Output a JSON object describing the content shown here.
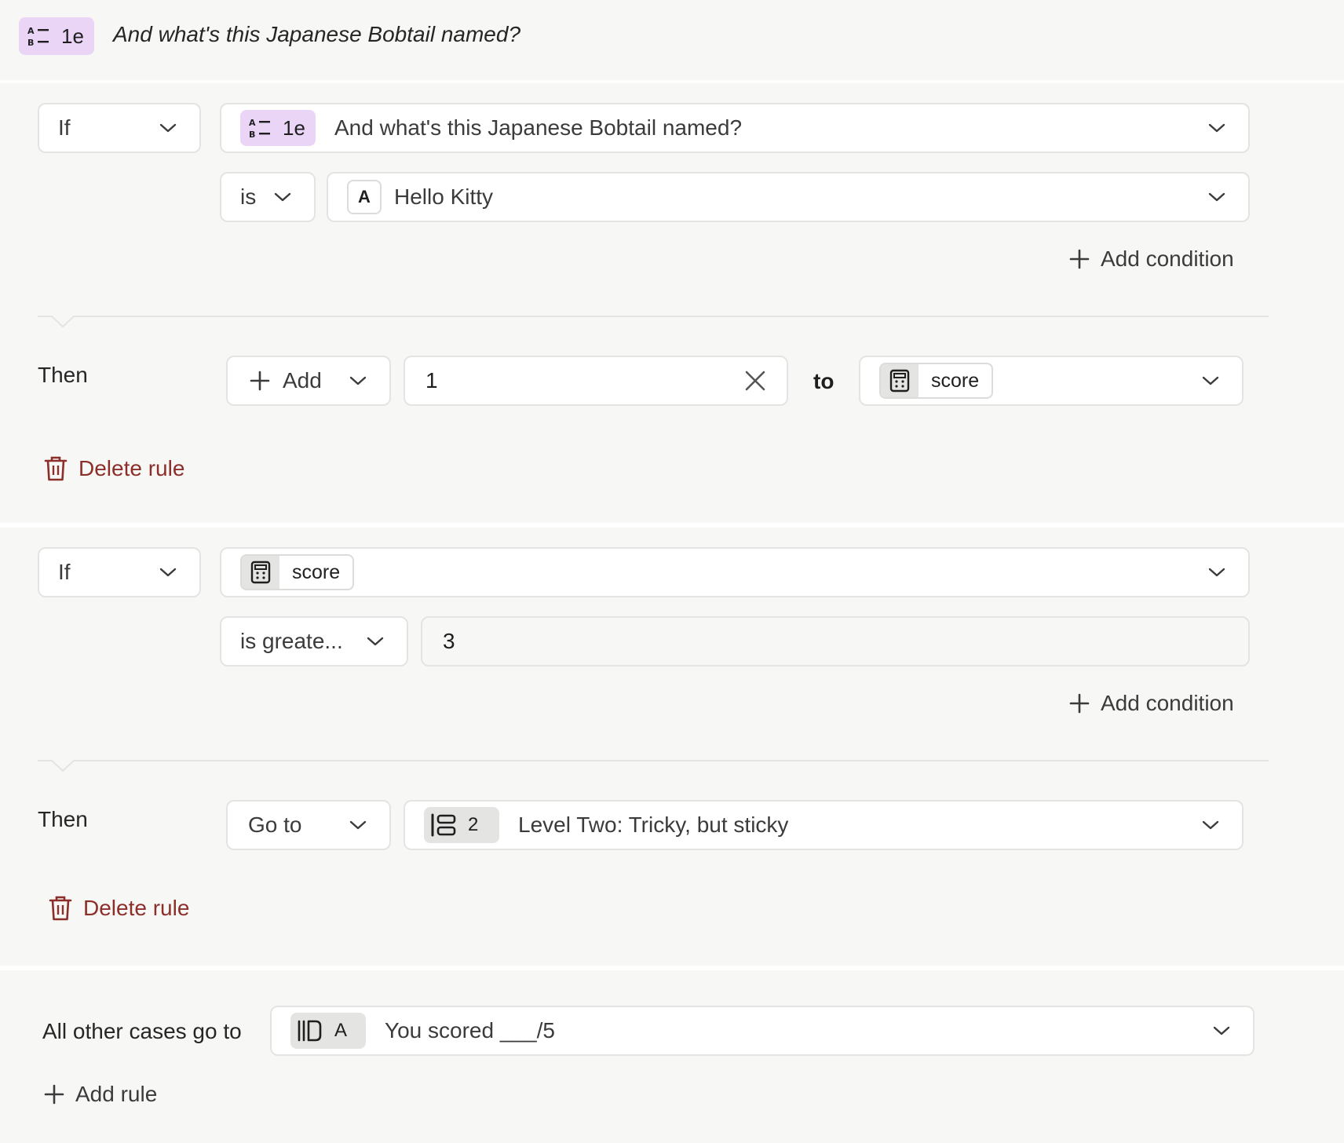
{
  "header": {
    "badge": "1e",
    "question": "And what's this Japanese Bobtail named?"
  },
  "rules": [
    {
      "if_label": "If",
      "subject_badge": "1e",
      "subject_text": "And what's this Japanese Bobtail named?",
      "operator": "is",
      "value_letter": "A",
      "value_text": "Hello Kitty",
      "add_condition": "Add condition",
      "then_label": "Then",
      "action": "Add",
      "amount": "1",
      "to_label": "to",
      "variable": "score",
      "delete": "Delete rule"
    },
    {
      "if_label": "If",
      "subject_variable": "score",
      "operator": "is greate...",
      "value": "3",
      "add_condition": "Add condition",
      "then_label": "Then",
      "action": "Go to",
      "target_badge": "2",
      "target_text": "Level Two: Tricky, but sticky",
      "delete": "Delete rule"
    }
  ],
  "fallback": {
    "label": "All other cases go to",
    "target_letter": "A",
    "target_text": "You scored ___/5"
  },
  "add_rule": "Add rule",
  "colors": {
    "badge_purple": "#ead5f6",
    "delete_red": "#8c2f2a",
    "panel_bg": "#f7f7f6",
    "border": "#e4e4e2"
  }
}
